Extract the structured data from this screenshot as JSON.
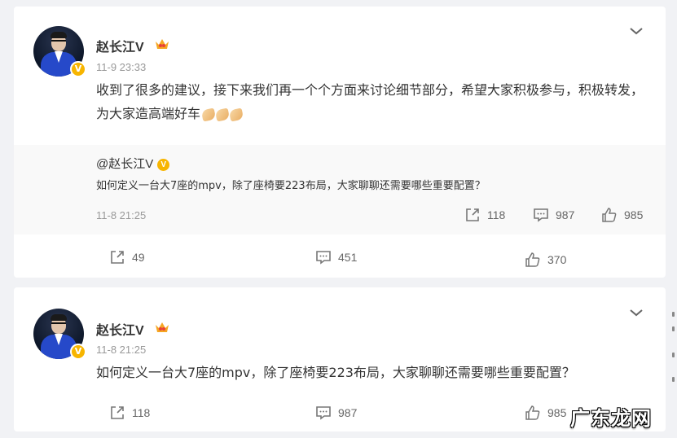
{
  "posts": [
    {
      "author": "赵长江V",
      "time": "11-9 23:33",
      "text": "收到了很多的建议，接下来我们再一个个方面来讨论细节部分，希望大家积极参与，积极转发，为大家造高端好车",
      "quote": {
        "author": "@赵长江V",
        "text": "如何定义一台大7座的mpv，除了座椅要223布局，大家聊聊还需要哪些重要配置？",
        "time": "11-8 21:25",
        "repost_count": "118",
        "comment_count": "987",
        "like_count": "985"
      },
      "repost_count": "49",
      "comment_count": "451",
      "like_count": "370"
    },
    {
      "author": "赵长江V",
      "time": "11-8 21:25",
      "text": "如何定义一台大7座的mpv，除了座椅要223布局，大家聊聊还需要哪些重要配置？",
      "repost_count": "118",
      "comment_count": "987",
      "like_count": "985"
    }
  ],
  "watermark": "广东龙网",
  "badge_letter": "V",
  "icons": {
    "repost": "share-icon",
    "comment": "comment-icon",
    "like": "thumbs-up-icon",
    "menu": "chevron-down-icon",
    "verified": "verified-badge-icon",
    "crown": "crown-icon"
  },
  "colors": {
    "page_bg": "#f1f2f5",
    "verified": "#f7b500",
    "muted": "#999999"
  }
}
